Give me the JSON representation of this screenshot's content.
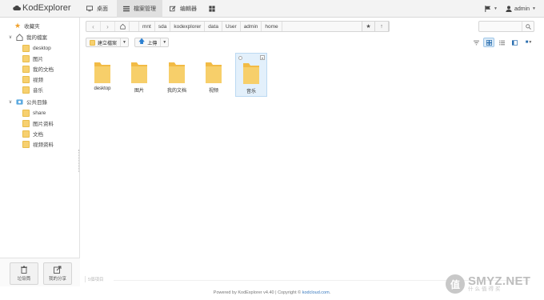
{
  "app": {
    "name": "KodExplorer"
  },
  "nav": {
    "tabs": [
      {
        "label": "桌面",
        "icon": "monitor-icon"
      },
      {
        "label": "檔案管理",
        "icon": "list-icon",
        "active": true
      },
      {
        "label": "编輯器",
        "icon": "edit-icon"
      },
      {
        "label": "",
        "icon": "grid-icon"
      }
    ],
    "user": "admin"
  },
  "sidebar": {
    "favorites": "收藏夾",
    "my_files": "我的檔案",
    "my_files_items": [
      "desktop",
      "图片",
      "我的文档",
      "视频",
      "音乐"
    ],
    "public": "公共目錄",
    "public_items": [
      "share",
      "图片资料",
      "文档",
      "视频资料"
    ],
    "recycle": "垃圾筒",
    "share": "我的分享"
  },
  "path": {
    "crumbs": [
      "mnt",
      "sda",
      "kodexplorer",
      "data",
      "User",
      "admin",
      "home"
    ],
    "search_placeholder": ""
  },
  "toolbar": {
    "new_folder": "建立檔案",
    "upload": "上傳"
  },
  "files": [
    {
      "name": "desktop"
    },
    {
      "name": "图片"
    },
    {
      "name": "我的文档"
    },
    {
      "name": "视频"
    },
    {
      "name": "音乐",
      "selected": true
    }
  ],
  "status": {
    "text": "5個項目"
  },
  "footer": {
    "text": "Powered by KodExplorer v4.40 | Copyright ©",
    "link": "kodcloud.com",
    "suffix": "."
  },
  "watermark": {
    "logo": "值",
    "big": "SMYZ.NET",
    "small": "什么值得买"
  },
  "colors": {
    "folder": "#f7c95b",
    "selected_bg": "#e3f0fb",
    "link": "#3a7bbf"
  }
}
